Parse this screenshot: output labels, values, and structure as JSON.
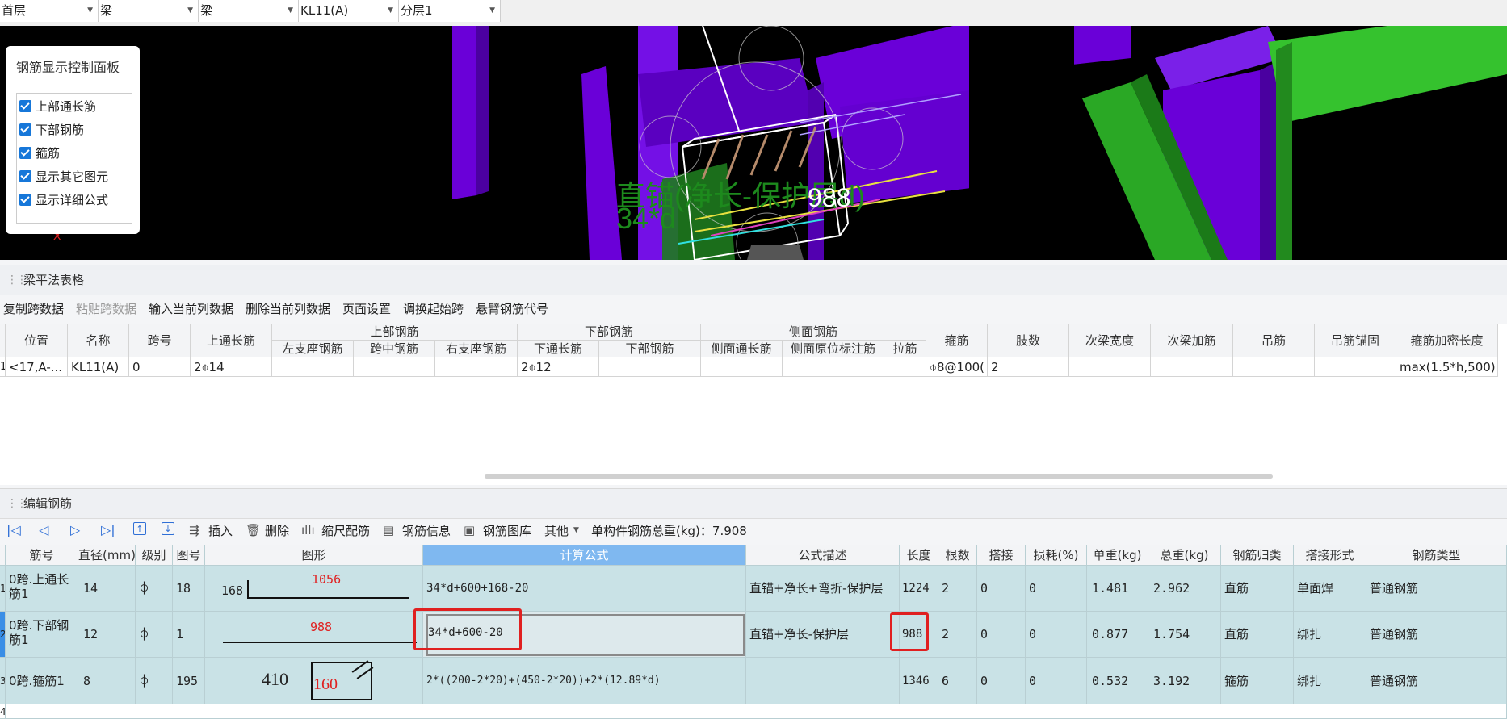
{
  "selectors": [
    "首层",
    "梁",
    "梁",
    "KL11(A)",
    "分层1"
  ],
  "viewport": {
    "panel_title": "钢筋显示控制面板",
    "options": [
      "上部通长筋",
      "下部钢筋",
      "箍筋",
      "显示其它图元",
      "显示详细公式"
    ],
    "overlay_text_1": "直锚(净长-保护层d)",
    "overlay_text_2": "34*d",
    "dim_988": "988"
  },
  "beam_section": {
    "title": "梁平法表格",
    "toolbar": [
      "复制跨数据",
      "粘贴跨数据",
      "输入当前列数据",
      "删除当前列数据",
      "页面设置",
      "调换起始跨",
      "悬臂钢筋代号"
    ],
    "group_headers": [
      "上部钢筋",
      "下部钢筋",
      "侧面钢筋"
    ],
    "headers": [
      "位置",
      "名称",
      "跨号",
      "上通长筋",
      "左支座钢筋",
      "跨中钢筋",
      "右支座钢筋",
      "下通长筋",
      "下部钢筋",
      "侧面通长筋",
      "侧面原位标注筋",
      "拉筋",
      "箍筋",
      "肢数",
      "次梁宽度",
      "次梁加筋",
      "吊筋",
      "吊筋锚固",
      "箍筋加密长度"
    ],
    "row": {
      "index": "1",
      "values": [
        "<17,A-...",
        "KL11(A)",
        "0",
        "2⌽14",
        "",
        "",
        "",
        "2⌽12",
        "",
        "",
        "",
        "",
        "⌽8@100(",
        "2",
        "",
        "",
        "",
        "",
        "max(1.5*h,500)"
      ]
    }
  },
  "rebar_section": {
    "title": "编辑钢筋",
    "toolbar": {
      "insert": "插入",
      "delete": "删除",
      "scale": "缩尺配筋",
      "info": "钢筋信息",
      "library": "钢筋图库",
      "other": "其他",
      "total_label": "单构件钢筋总重(kg)：7.908"
    },
    "headers": [
      "筋号",
      "直径(mm)",
      "级别",
      "图号",
      "图形",
      "计算公式",
      "公式描述",
      "长度",
      "根数",
      "搭接",
      "损耗(%)",
      "单重(kg)",
      "总重(kg)",
      "钢筋归类",
      "搭接形式",
      "钢筋类型"
    ],
    "rows": [
      {
        "index": "1",
        "name": "0跨.上通长筋1",
        "dia": "14",
        "grade": "⌽",
        "fig": "18",
        "shape_a": "168",
        "shape_b": "1056",
        "formula": "34*d+600+168-20",
        "desc": "直锚+净长+弯折-保护层",
        "length": "1224",
        "count": "2",
        "lap": "0",
        "loss": "0",
        "unit_w": "1.481",
        "total_w": "2.962",
        "cat": "直筋",
        "lap_form": "单面焊",
        "type": "普通钢筋"
      },
      {
        "index": "2",
        "name": "0跨.下部钢筋1",
        "dia": "12",
        "grade": "⌽",
        "fig": "1",
        "shape_a": "",
        "shape_b": "988",
        "formula": "34*d+600-20",
        "desc": "直锚+净长-保护层",
        "length": "988",
        "count": "2",
        "lap": "0",
        "loss": "0",
        "unit_w": "0.877",
        "total_w": "1.754",
        "cat": "直筋",
        "lap_form": "绑扎",
        "type": "普通钢筋"
      },
      {
        "index": "3",
        "name": "0跨.箍筋1",
        "dia": "8",
        "grade": "⌽",
        "fig": "195",
        "shape_a": "410",
        "shape_b": "160",
        "formula": "2*((200-2*20)+(450-2*20))+2*(12.89*d)",
        "desc": "",
        "length": "1346",
        "count": "6",
        "lap": "0",
        "loss": "0",
        "unit_w": "0.532",
        "total_w": "3.192",
        "cat": "箍筋",
        "lap_form": "绑扎",
        "type": "普通钢筋"
      }
    ],
    "next_index": "4"
  },
  "colors": {
    "accent": "#1677d9",
    "selected_header": "#7fb8f0",
    "row_bg": "#c9e2e6",
    "highlight": "#e02020",
    "purple": "#6a00d8",
    "green": "#2fb82f"
  }
}
